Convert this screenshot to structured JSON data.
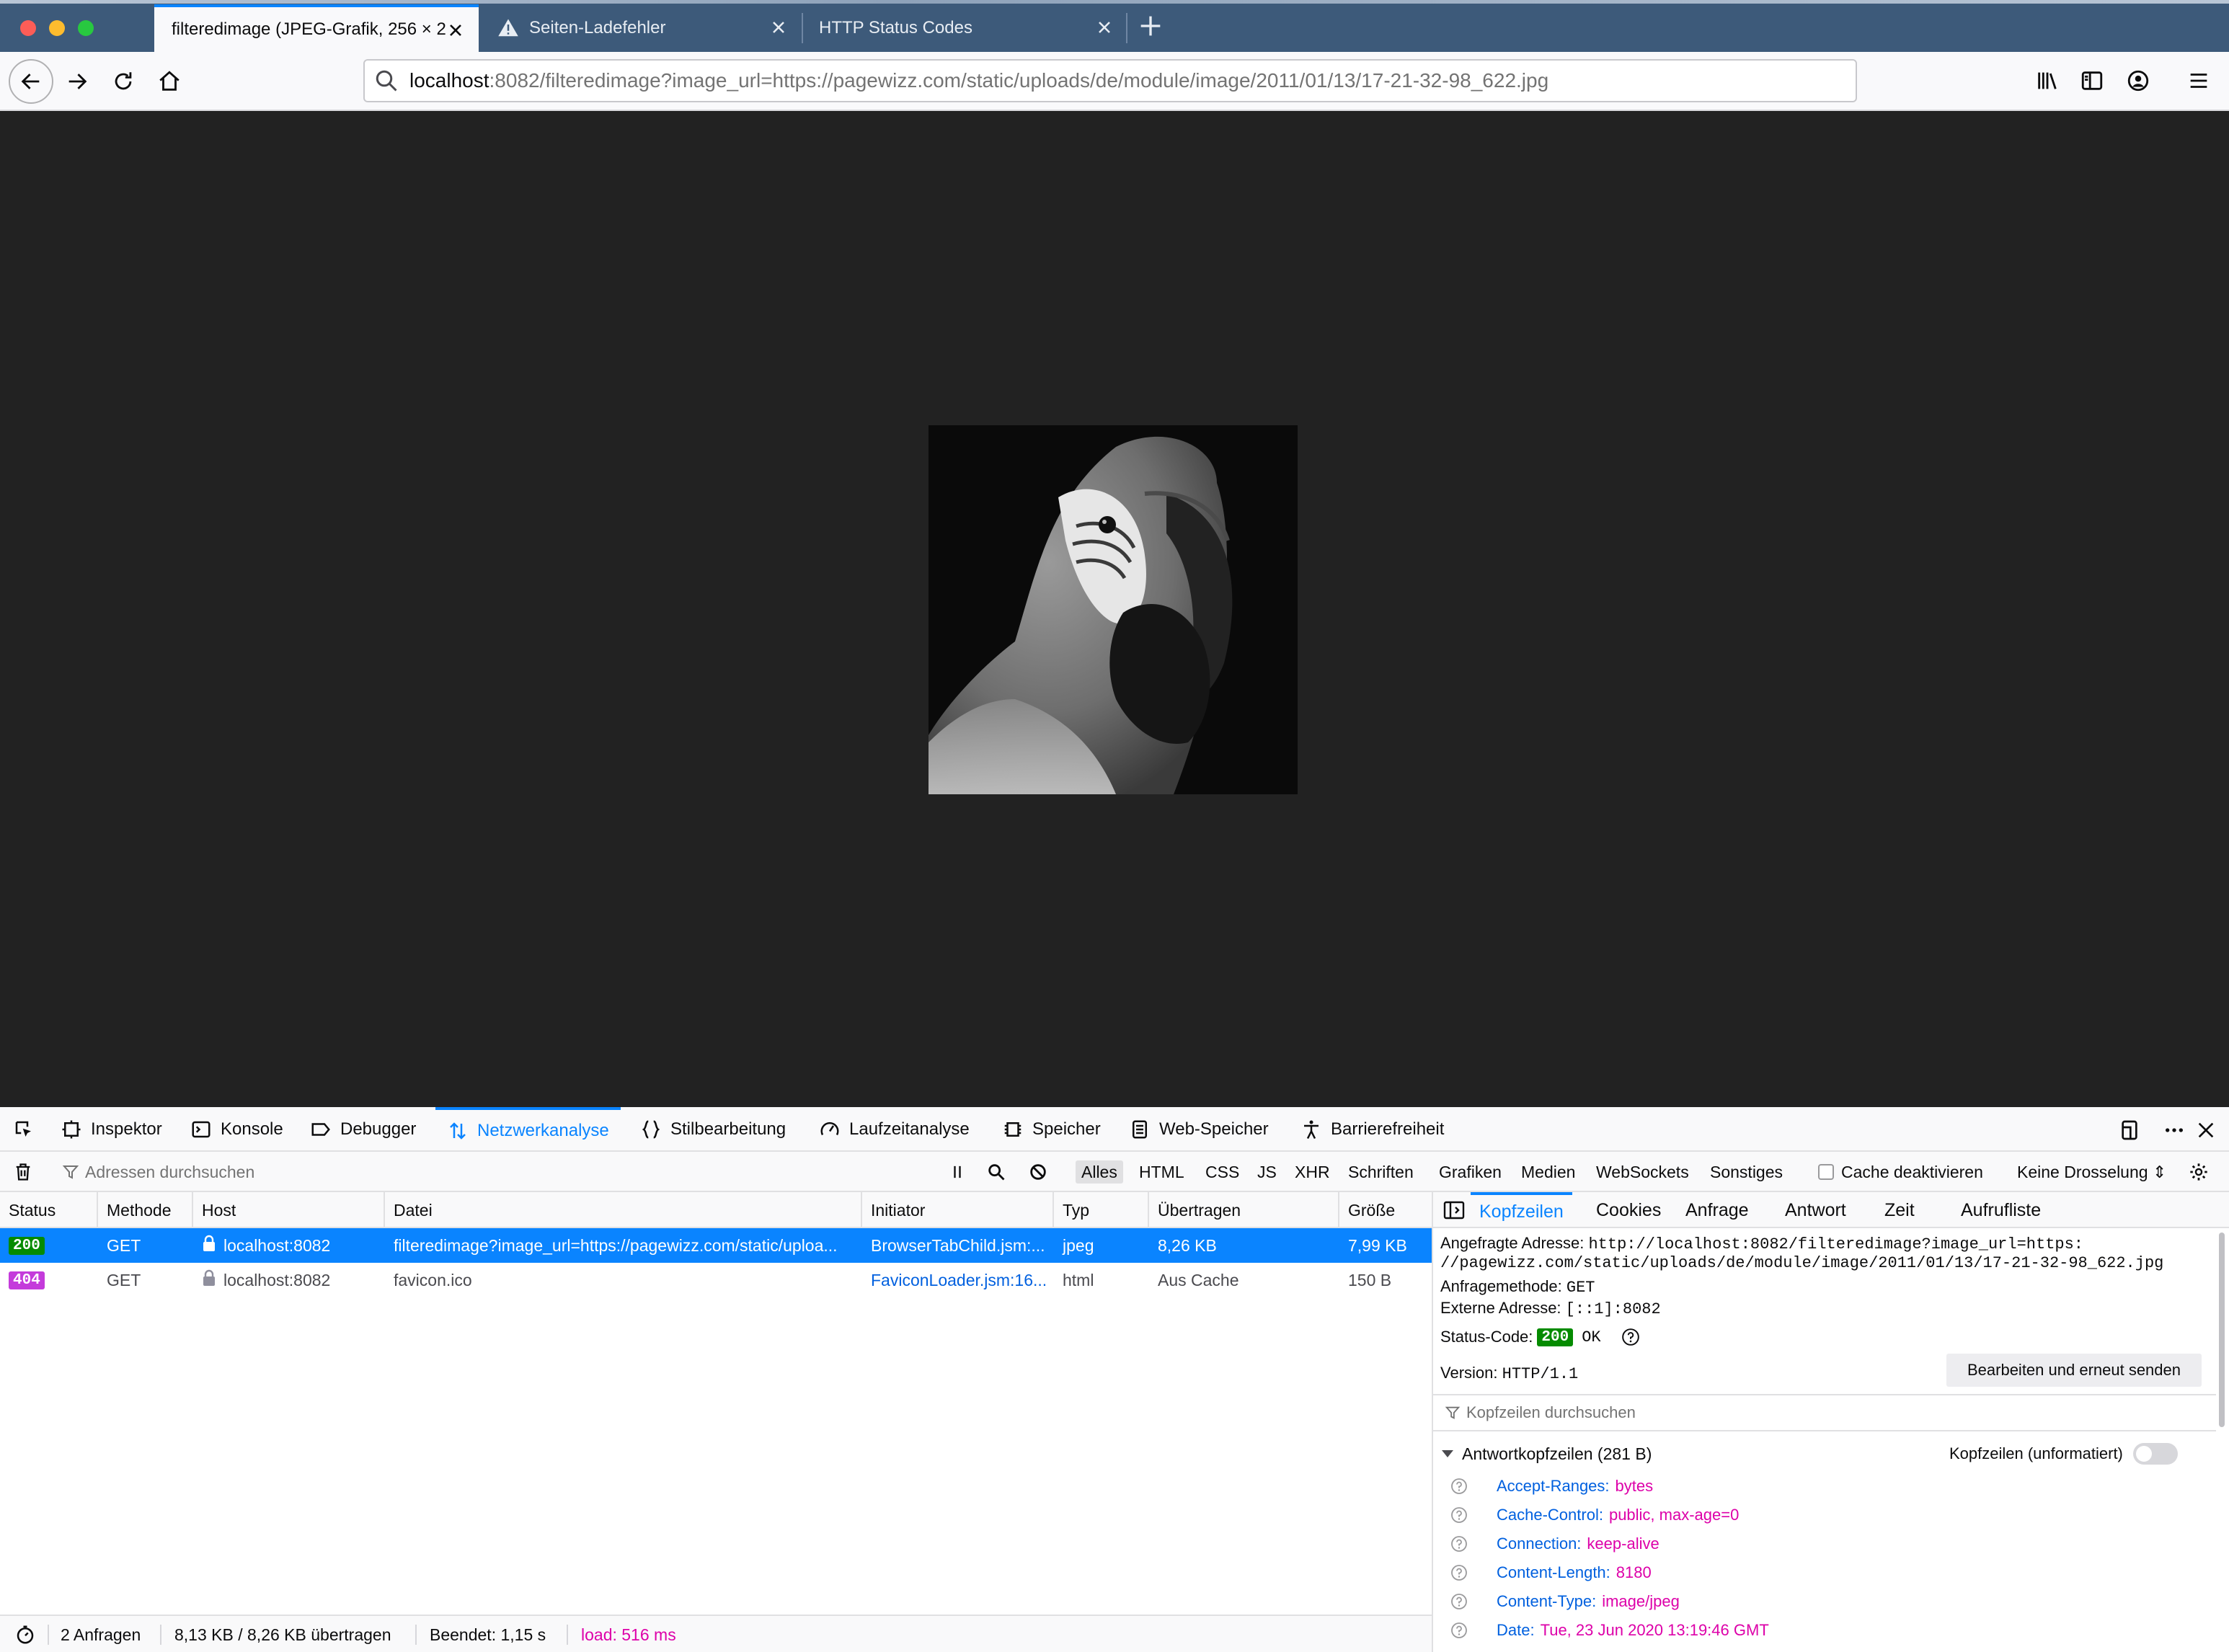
{
  "window": {
    "traffic_lights": [
      "close",
      "minimize",
      "zoom"
    ]
  },
  "tabs": [
    {
      "title": "filteredimage (JPEG-Grafik, 256 × 2",
      "active": true,
      "icon": "none"
    },
    {
      "title": "Seiten-Ladefehler",
      "active": false,
      "icon": "warning-icon"
    },
    {
      "title": "HTTP Status Codes",
      "active": false,
      "icon": "none"
    }
  ],
  "urlbar": {
    "host": "localhost",
    "path": ":8082/filteredimage?image_url=https://pagewizz.com/static/uploads/de/module/image/2011/01/13/17-21-32-98_622.jpg"
  },
  "devtools": {
    "tabs": {
      "inspektor": "Inspektor",
      "konsole": "Konsole",
      "debugger": "Debugger",
      "netz": "Netzwerkanalyse",
      "stil": "Stilbearbeitung",
      "lauf": "Laufzeitanalyse",
      "speicher": "Speicher",
      "web": "Web-Speicher",
      "barriere": "Barrierefreiheit"
    },
    "active_tab": "Netzwerkanalyse"
  },
  "network": {
    "filter_placeholder": "Adressen durchsuchen",
    "types": [
      "Alles",
      "HTML",
      "CSS",
      "JS",
      "XHR",
      "Schriften",
      "Grafiken",
      "Medien",
      "WebSockets",
      "Sonstiges"
    ],
    "active_type": "Alles",
    "cache_label": "Cache deaktivieren",
    "throttle_label": "Keine Drosselung ⇕",
    "columns": {
      "status": "Status",
      "method": "Methode",
      "host": "Host",
      "file": "Datei",
      "initiator": "Initiator",
      "type": "Typ",
      "transferred": "Übertragen",
      "size": "Größe"
    },
    "requests": [
      {
        "status": "200",
        "status_color": "#058b00",
        "method": "GET",
        "host": "localhost:8082",
        "file": "filteredimage?image_url=https://pagewizz.com/static/uploa...",
        "initiator": "BrowserTabChild.jsm:...",
        "type": "jpeg",
        "transferred": "8,26 KB",
        "size": "7,99 KB",
        "selected": true
      },
      {
        "status": "404",
        "status_color": "#c43bdb",
        "method": "GET",
        "host": "localhost:8082",
        "file": "favicon.ico",
        "initiator": "FaviconLoader.jsm:16...",
        "type": "html",
        "transferred": "Aus Cache",
        "size": "150 B",
        "selected": false
      }
    ],
    "summary": {
      "requests": "2 Anfragen",
      "transferred": "8,13 KB / 8,26 KB übertragen",
      "finished": "Beendet: 1,15 s",
      "load": "load: 516 ms"
    }
  },
  "panel": {
    "tabs": [
      "Kopfzeilen",
      "Cookies",
      "Anfrage",
      "Antwort",
      "Zeit",
      "Aufrufliste"
    ],
    "active_tab": "Kopfzeilen",
    "url_label": "Angefragte Adresse:",
    "url_line1": "http://localhost:8082/filteredimage?image_url=https:",
    "url_line2": "//pagewizz.com/static/uploads/de/module/image/2011/01/13/17-21-32-98_622.jpg",
    "method_label": "Anfragemethode:",
    "method_value": "GET",
    "remote_label": "Externe Adresse:",
    "remote_value": "[::1]:8082",
    "status_label": "Status-Code:",
    "status_code": "200",
    "status_text": "OK",
    "version_label": "Version:",
    "version_value": "HTTP/1.1",
    "resend_label": "Bearbeiten und erneut senden",
    "filter_placeholder": "Kopfzeilen durchsuchen",
    "section_label": "Antwortkopfzeilen (281 B)",
    "raw_label": "Kopfzeilen (unformatiert)",
    "headers": [
      {
        "name": "Accept-Ranges:",
        "value": "bytes"
      },
      {
        "name": "Cache-Control:",
        "value": "public, max-age=0"
      },
      {
        "name": "Connection:",
        "value": "keep-alive"
      },
      {
        "name": "Content-Length:",
        "value": "8180"
      },
      {
        "name": "Content-Type:",
        "value": "image/jpeg"
      },
      {
        "name": "Date:",
        "value": "Tue, 23 Jun 2020 13:19:46 GMT"
      }
    ]
  },
  "colors": {
    "accent": "#0a84ff",
    "status_ok": "#058b00",
    "status_404": "#c43bdb",
    "header_name": "#0060df",
    "header_value": "#dd00a9",
    "load_text": "#dd00a9"
  },
  "icons": [
    "back-arrow-icon",
    "forward-arrow-icon",
    "reload-icon",
    "home-icon",
    "search-icon",
    "library-icon",
    "sidebar-icon",
    "account-icon",
    "hamburger-menu-icon",
    "warning-icon",
    "close-icon",
    "plus-icon",
    "picker-icon",
    "trash-icon",
    "filter-icon",
    "pause-icon",
    "block-icon",
    "gear-icon",
    "lock-icon",
    "help-icon"
  ]
}
